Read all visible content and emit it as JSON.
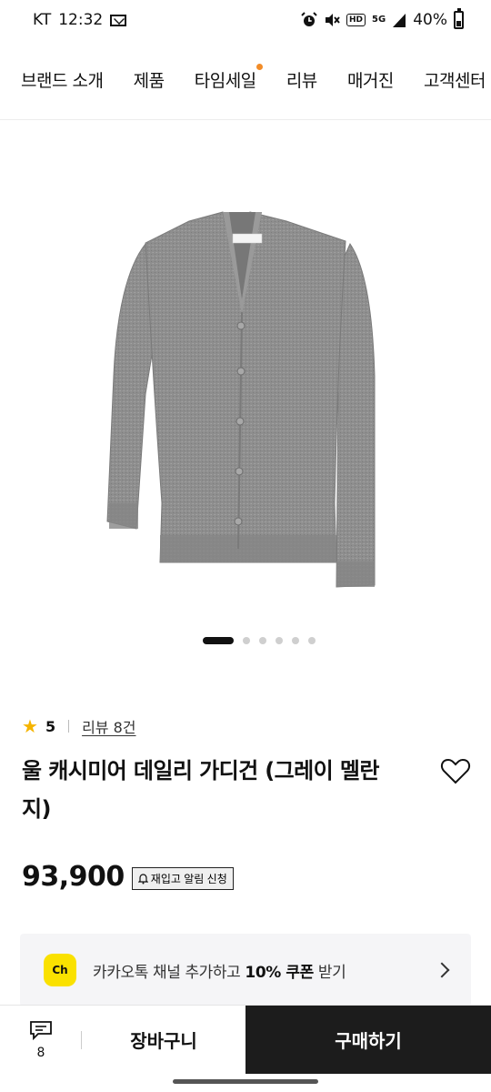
{
  "status_bar": {
    "carrier": "KT",
    "time": "12:32",
    "network": "5G",
    "hd": "HD",
    "battery_percent": "40%",
    "battery_level": 0.4,
    "icons": [
      "mail-icon",
      "alarm-icon",
      "mute-icon",
      "hd-icon",
      "5g-icon",
      "signal-icon",
      "battery-icon"
    ]
  },
  "nav": {
    "items": [
      {
        "label": "브랜드 소개"
      },
      {
        "label": "제품"
      },
      {
        "label": "타임세일",
        "dot_color": "#f28c28"
      },
      {
        "label": "리뷰"
      },
      {
        "label": "매거진"
      },
      {
        "label": "고객센터"
      }
    ]
  },
  "gallery": {
    "total_slides": 6,
    "active_index": 0
  },
  "product": {
    "rating": "5",
    "review_link": "리뷰 8건",
    "title": "울 캐시미어 데일리 가디건 (그레이 멜란지)",
    "price": "93,900",
    "restock_label": "재입고 알림 신청",
    "colors": {
      "garment": "#8f8f8f",
      "star": "#f5b400"
    }
  },
  "kakao_banner": {
    "icon_text": "Ch",
    "text_prefix": "카카오톡 채널 추가하고 ",
    "text_bold": "10% 쿠폰",
    "text_suffix": " 받기",
    "color": "#fae100"
  },
  "bottom_bar": {
    "chat_count": "8",
    "cart_label": "장바구니",
    "buy_label": "구매하기",
    "buy_color": "#1c1c1c"
  }
}
